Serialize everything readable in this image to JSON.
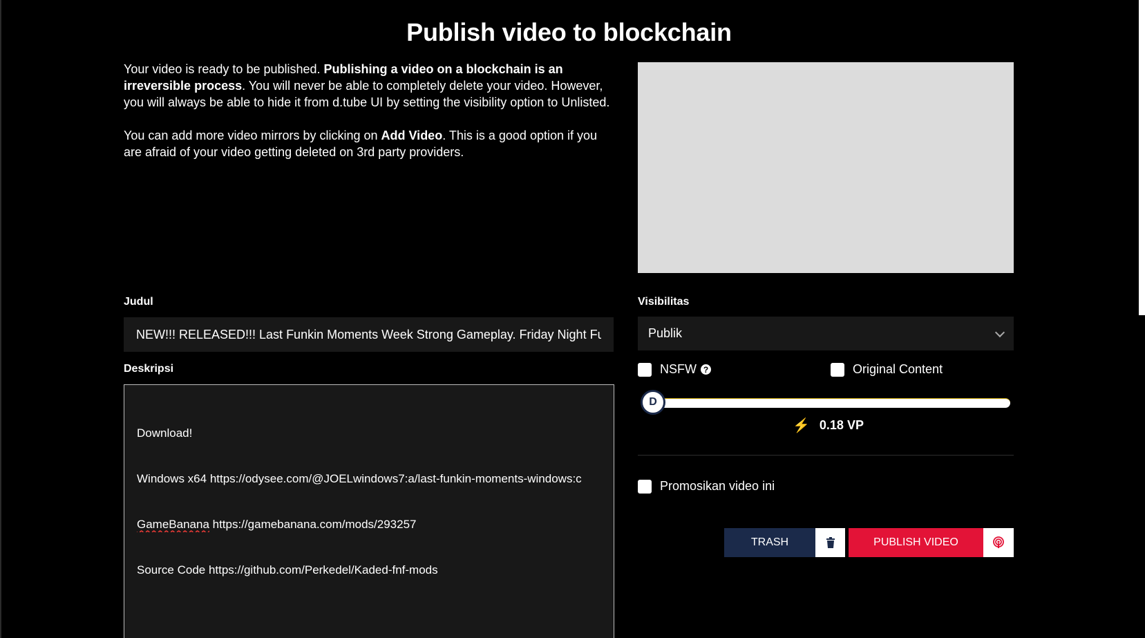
{
  "page": {
    "title": "Publish video to blockchain"
  },
  "intro": {
    "p1_a": "Your video is ready to be published. ",
    "p1_bold": "Publishing a video on a blockchain is an irreversible process",
    "p1_b": ". You will never be able to completely delete your video. However, you will always be able to hide it from d.tube UI by setting the visibility option to Unlisted.",
    "p2_a": "You can add more video mirrors by clicking on ",
    "p2_bold": "Add Video",
    "p2_b": ". This is a good option if you are afraid of your video getting deleted on 3rd party providers."
  },
  "form": {
    "title_label": "Judul",
    "title_value": "NEW!!! RELEASED!!! Last Funkin Moments Week Strong Gameplay. Friday Night Funkin",
    "description_label": "Deskripsi",
    "description_lines": {
      "l1": "Download!",
      "l2": "Windows x64 https://odysee.com/@JOELwindows7:a/last-funkin-moments-windows:c",
      "l3_spell": "GameBanana",
      "l3_rest": " https://gamebanana.com/mods/293257",
      "l4": "Source Code https://github.com/Perkedel/Kaded-fnf-mods",
      "l5": "",
      "l6": "..."
    }
  },
  "settings": {
    "visibility_label": "Visibilitas",
    "visibility_value": "Publik",
    "nsfw_label": "NSFW",
    "nsfw_checked": false,
    "original_label": "Original Content",
    "original_checked": false,
    "knob_letter": "D",
    "vp_fraction": 0,
    "vp_text": "0.18 VP",
    "promote_label": "Promosikan video ini",
    "promote_checked": false
  },
  "actions": {
    "trash_label": "TRASH",
    "publish_label": "PUBLISH VIDEO"
  },
  "colors": {
    "publish": "#e31337",
    "trash": "#1b2a4a",
    "bolt": "#f6b100"
  },
  "icons": {
    "help": "question-circle-icon",
    "chevron": "chevron-down-icon",
    "bolt": "lightning-bolt-icon",
    "trash": "trash-icon",
    "publish": "broadcast-icon"
  }
}
